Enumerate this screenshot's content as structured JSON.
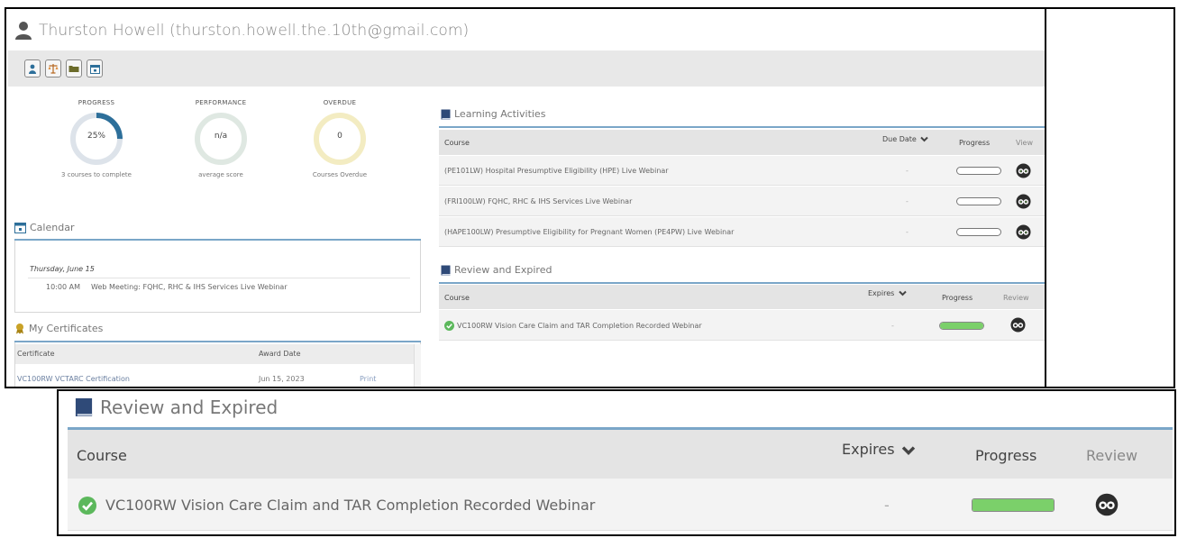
{
  "header": {
    "title": "Thurston Howell (thurston.howell.the.10th@gmail.com)"
  },
  "toolbar": {
    "icons": [
      "user-icon",
      "scales-icon",
      "folder-icon",
      "calendar-icon"
    ]
  },
  "stats": {
    "progress": {
      "label": "PROGRESS",
      "value": "25%",
      "fraction": 0.25,
      "sub": "3 courses to complete"
    },
    "performance": {
      "label": "PERFORMANCE",
      "value": "n/a",
      "sub": "average score"
    },
    "overdue": {
      "label": "OVERDUE",
      "value": "0",
      "sub": "Courses Overdue"
    }
  },
  "calendar": {
    "title": "Calendar",
    "day": "Thursday, June 15",
    "time": "10:00 AM",
    "event": "Web Meeting: FQHC, RHC & IHS Services Live Webinar"
  },
  "certificates": {
    "title": "My Certificates",
    "columns": [
      "Certificate",
      "Award Date"
    ],
    "rows": [
      {
        "certificate": "VC100RW VCTARC Certification",
        "award_date": "Jun 15, 2023",
        "action": "Print"
      }
    ]
  },
  "learning_activities": {
    "title": "Learning Activities",
    "columns": {
      "course": "Course",
      "due_date": "Due Date",
      "progress": "Progress",
      "view": "View"
    },
    "rows": [
      {
        "course": "(PE101LW) Hospital Presumptive Eligibility (HPE) Live Webinar",
        "due": "-",
        "progress": 0
      },
      {
        "course": "(FRI100LW) FQHC, RHC & IHS Services Live Webinar",
        "due": "-",
        "progress": 0
      },
      {
        "course": "(HAPE100LW) Presumptive Eligibility for Pregnant Women (PE4PW) Live Webinar",
        "due": "-",
        "progress": 0
      }
    ]
  },
  "review_expired": {
    "title": "Review and Expired",
    "columns": {
      "course": "Course",
      "expires": "Expires",
      "progress": "Progress",
      "review": "Review"
    },
    "rows": [
      {
        "course": "VC100RW Vision Care Claim and TAR Completion Recorded Webinar",
        "expires": "-",
        "progress": 1.0
      }
    ]
  },
  "colors": {
    "accent_blue": "#2d6f9a",
    "progress_green": "#7bd06a",
    "check_green": "#5cb85c",
    "rule_blue": "#7aa6c8"
  }
}
